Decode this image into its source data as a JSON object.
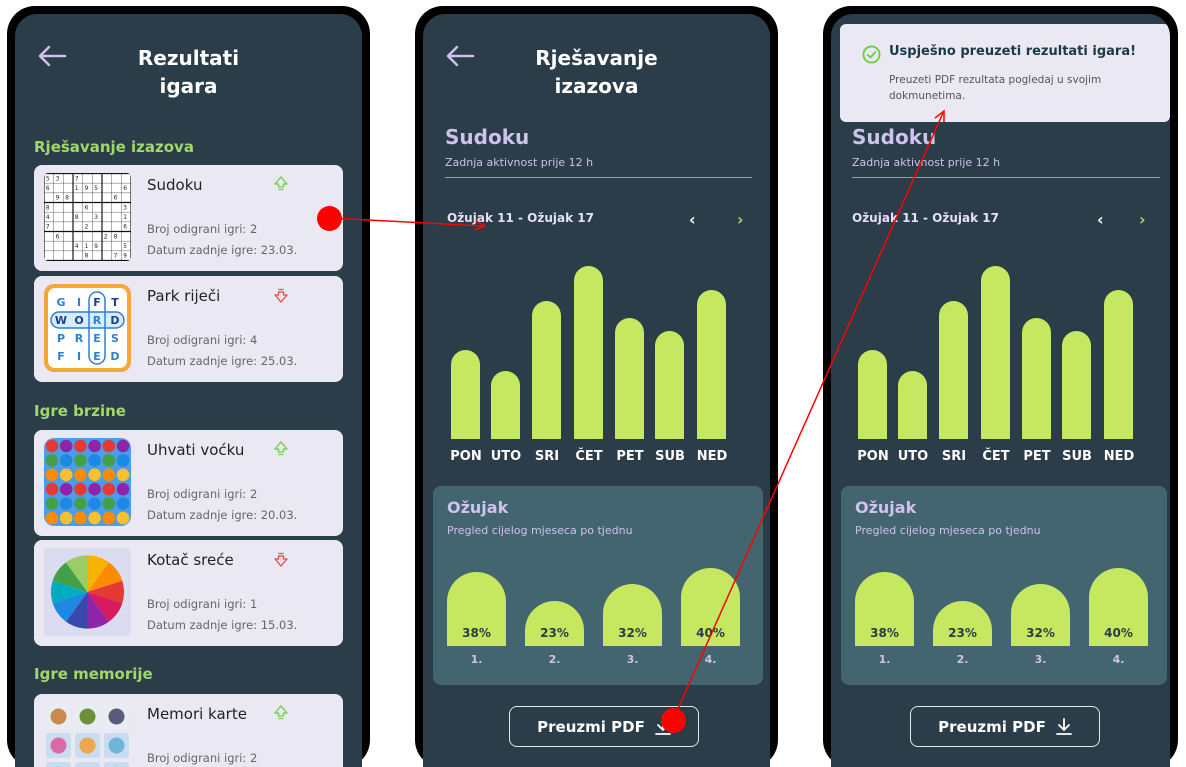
{
  "phone1": {
    "title_line1": "Rezultati",
    "title_line2": "igara",
    "sections": [
      {
        "title": "Rješavanje izazova",
        "games": [
          {
            "name": "Sudoku",
            "trend": "up",
            "played": "Broj odigrani igri: 2",
            "last": "Datum zadnje igre: 23.03."
          },
          {
            "name": "Park riječi",
            "trend": "down",
            "played": "Broj odigrani igri: 4",
            "last": "Datum zadnje igre: 25.03."
          }
        ]
      },
      {
        "title": "Igre brzine",
        "games": [
          {
            "name": "Uhvati voćku",
            "trend": "up",
            "played": "Broj odigrani igri: 2",
            "last": "Datum zadnje igre: 20.03."
          },
          {
            "name": "Kotač sreće",
            "trend": "down",
            "played": "Broj odigrani igri: 1",
            "last": "Datum zadnje igre: 15.03."
          }
        ]
      },
      {
        "title": "Igre memorije",
        "games": [
          {
            "name": "Memori karte",
            "trend": "up",
            "played": "Broj odigrani igri: 2",
            "last": ""
          }
        ]
      }
    ],
    "wordsearch_letters": [
      "G",
      "I",
      "F",
      "T",
      "W",
      "O",
      "R",
      "D",
      "P",
      "R",
      "E",
      "S",
      "F",
      "I",
      "E",
      "D"
    ]
  },
  "phone2": {
    "title_line1": "Rješavanje",
    "title_line2": "izazova",
    "game": "Sudoku",
    "last_activity": "Zadnja aktivnost prije 12 h",
    "week_range": "Ožujak 11 - Ožujak 17",
    "prev": "‹",
    "next": "›",
    "month": "Ožujak",
    "month_sub": "Pregled cijelog mjeseca po tjednu",
    "pdf_button": "Preuzmi PDF"
  },
  "phone3": {
    "toast_title": "Uspješno preuzeti rezultati igara!",
    "toast_msg": "Preuzeti PDF rezultata pogledaj u svojim dokmunetima.",
    "game": "Sudoku",
    "last_activity": "Zadnja aktivnost prije 12 h",
    "week_range": "Ožujak 11 - Ožujak 17",
    "prev": "‹",
    "next": "›",
    "month": "Ožujak",
    "month_sub": "Pregled cijelog mjeseca po tjednu",
    "pdf_button": "Preuzmi PDF"
  },
  "colors": {
    "accent_green": "#9fd96a",
    "bar_green": "#c6e860",
    "screen_bg": "#2a3d48",
    "panel_bg": "#43656f",
    "lavender": "#cfc2ec",
    "trend_up": "#6ccf4a",
    "trend_down": "#e84848",
    "annotation_red": "#ff0000"
  },
  "chart_data": [
    {
      "type": "bar",
      "title": "Ožujak 11 - Ožujak 17",
      "categories": [
        "PON",
        "UTO",
        "SRI",
        "ČET",
        "PET",
        "SUB",
        "NED"
      ],
      "values": [
        55,
        42,
        85,
        107,
        75,
        67,
        92
      ],
      "ylim": [
        0,
        110
      ],
      "grid": false
    },
    {
      "type": "bar",
      "title": "Ožujak",
      "categories": [
        "1.",
        "2.",
        "3.",
        "4."
      ],
      "values": [
        38,
        23,
        32,
        40
      ],
      "value_labels": [
        "38%",
        "23%",
        "32%",
        "40%"
      ],
      "ylim": [
        0,
        40
      ]
    }
  ]
}
